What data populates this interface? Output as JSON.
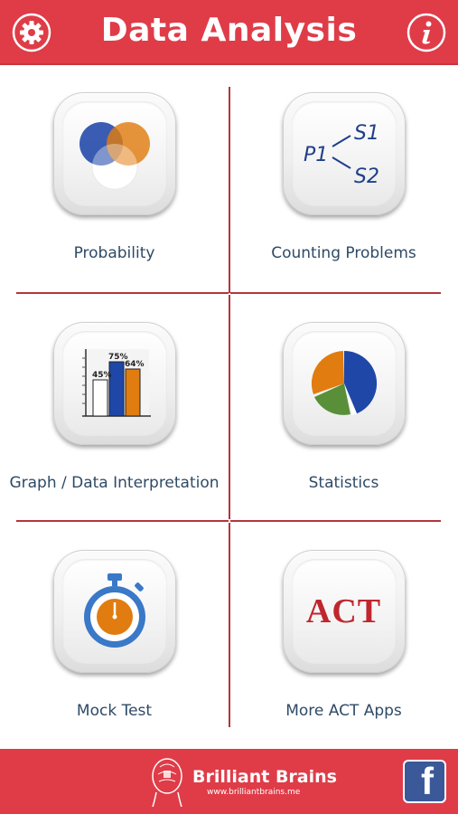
{
  "header": {
    "title": "Data Analysis",
    "settings_icon": "gear-icon",
    "info_icon": "info-icon"
  },
  "menu": [
    {
      "label": "Probability",
      "icon": "venn-diagram-icon"
    },
    {
      "label": "Counting Problems",
      "icon": "tree-diagram-icon",
      "icon_text": {
        "root": "P1",
        "branch_top": "S1",
        "branch_bottom": "S2"
      }
    },
    {
      "label": "Graph / Data Interpretation",
      "icon": "bar-chart-icon",
      "icon_text": {
        "bar1": "45%",
        "bar2": "75%",
        "bar3": "64%"
      }
    },
    {
      "label": "Statistics",
      "icon": "pie-chart-icon"
    },
    {
      "label": "Mock Test",
      "icon": "stopwatch-icon"
    },
    {
      "label": "More ACT Apps",
      "icon": "act-logo-icon",
      "icon_text": "ACT"
    }
  ],
  "footer": {
    "brand_name": "Brilliant Brains",
    "brand_url": "www.brilliantbrains.me",
    "social_icon": "facebook-icon",
    "social_letter": "f"
  },
  "colors": {
    "header_bg": "#df3c48",
    "divider": "#b5343c",
    "label_text": "#2e4a66",
    "act_red": "#c0262e",
    "blue": "#1f47a8",
    "orange": "#e07c10",
    "green": "#5a8f3a"
  }
}
